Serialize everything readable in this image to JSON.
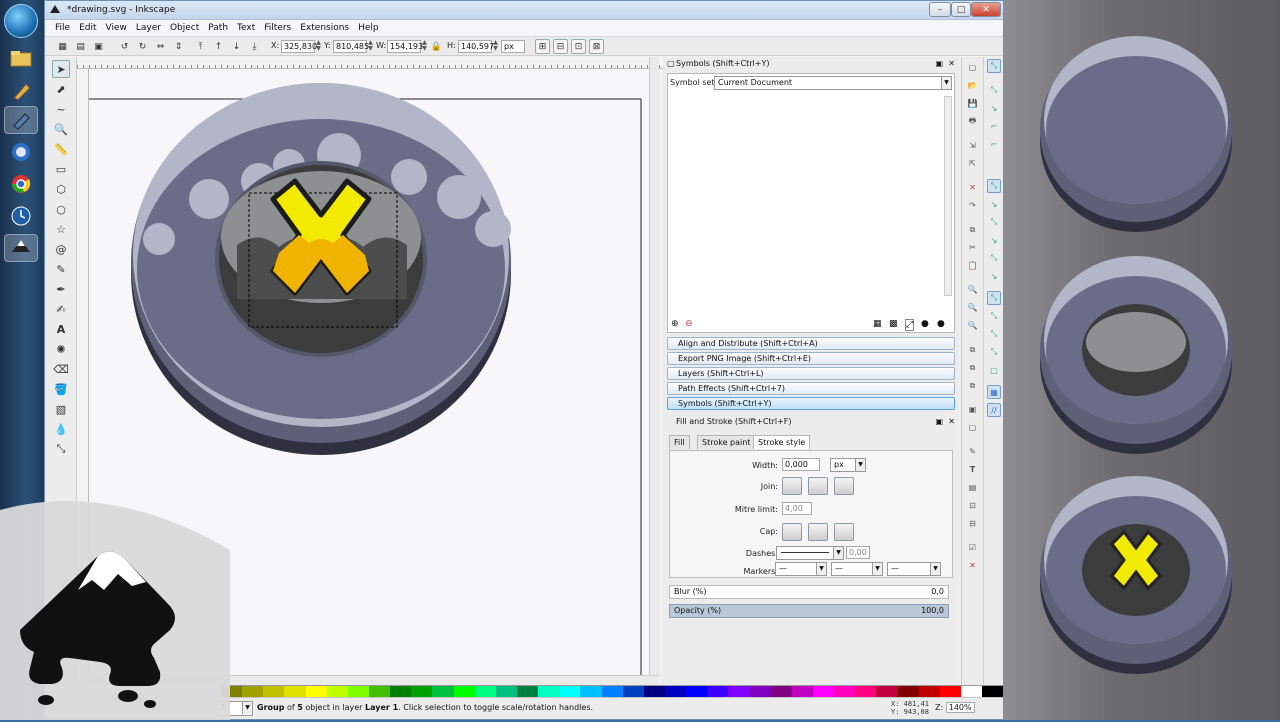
{
  "window": {
    "title": "*drawing.svg - Inkscape",
    "controls": [
      "–",
      "□",
      "✕"
    ]
  },
  "menubar": [
    "File",
    "Edit",
    "View",
    "Layer",
    "Object",
    "Path",
    "Text",
    "Filters",
    "Extensions",
    "Help"
  ],
  "toolbar": {
    "x_label": "X:",
    "x_value": "325,830",
    "y_label": "Y:",
    "y_value": "810,485",
    "w_label": "W:",
    "w_value": "154,193",
    "h_label": "H:",
    "h_value": "140,597",
    "unit": "px"
  },
  "symbols_panel": {
    "title": "Symbols (Shift+Ctrl+Y)",
    "symbol_set_label": "Symbol set:",
    "symbol_set_value": "Current Document"
  },
  "collapsed_panels": [
    "Align and Distribute (Shift+Ctrl+A)",
    "Export PNG Image (Shift+Ctrl+E)",
    "Layers (Shift+Ctrl+L)",
    "Path Effects  (Shift+Ctrl+7)",
    "Symbols (Shift+Ctrl+Y)"
  ],
  "fill_stroke": {
    "title": "Fill and Stroke (Shift+Ctrl+F)",
    "tabs": [
      "Fill",
      "Stroke paint",
      "Stroke style"
    ],
    "width_label": "Width:",
    "width_value": "0,000",
    "width_unit": "px",
    "join_label": "Join:",
    "mitre_label": "Mitre limit:",
    "mitre_value": "4,00",
    "cap_label": "Cap:",
    "dashes_label": "Dashes:",
    "dashes_value": "0,00",
    "markers_label": "Markers:",
    "blur_label": "Blur (%)",
    "blur_value": "0,0",
    "opacity_label": "Opacity (%)",
    "opacity_value": "100,0"
  },
  "status": {
    "layer_num": "1",
    "message_prefix": "Group",
    "message_mid1": " of ",
    "count": "5",
    "message_mid2": " object in layer ",
    "layer": "Layer 1",
    "message_suffix": ". Click selection to toggle scale/rotation handles.",
    "x_coord": "X: 481,41",
    "y_coord": "Y: 943,08",
    "zoom_label": "Z:",
    "zoom": "140%"
  },
  "palette_colors": [
    "#808000",
    "#a0a000",
    "#c0c000",
    "#e0e000",
    "#ffff00",
    "#c0ff00",
    "#80ff00",
    "#40c000",
    "#008000",
    "#00a000",
    "#00c040",
    "#00ff00",
    "#00ff80",
    "#00c080",
    "#008040",
    "#00ffc0",
    "#00ffff",
    "#00c0ff",
    "#0080ff",
    "#0040c0",
    "#000080",
    "#0000c0",
    "#0000ff",
    "#4000ff",
    "#8000ff",
    "#8000c0",
    "#800080",
    "#c000c0",
    "#ff00ff",
    "#ff00c0",
    "#ff0080",
    "#c00040",
    "#800000",
    "#c00000",
    "#ff0000",
    "#ffffff",
    "#000000"
  ],
  "colors": {
    "accent": "#56a2db",
    "stone_dark": "#5e6078",
    "stone_light": "#b3b5c9",
    "yellow": "#f2ea00",
    "orange": "#f0b400"
  }
}
